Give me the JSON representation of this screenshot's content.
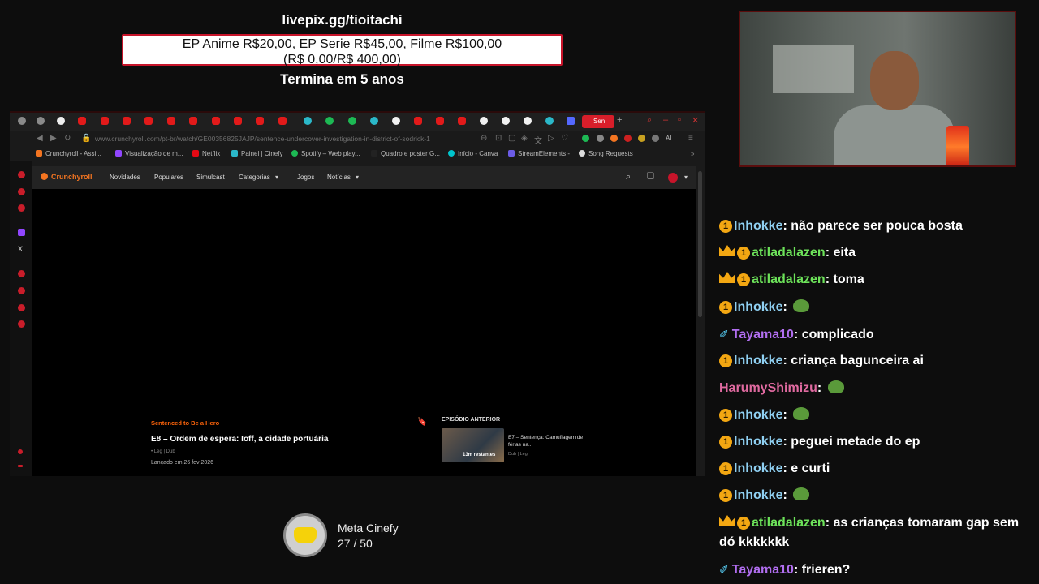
{
  "overlay": {
    "url": "livepix.gg/tioitachi",
    "prices_line1": "EP Anime R$20,00, EP Serie R$45,00, Filme R$100,00",
    "prices_line2": "(R$ 0,00/R$ 400,00)",
    "ends": "Termina em 5 anos"
  },
  "browser": {
    "active_tab": "Sen",
    "url": "www.crunchyroll.com/pt-br/watch/GE00356825JAJP/sentence-undercover-investigation-in-district-of-sodrick-1",
    "bookmarks": [
      "Crunchyroll - Assi...",
      "Visualização de m...",
      "Netflix",
      "Painel | Cinefy",
      "Spotify – Web play...",
      "Quadro e poster G...",
      "Início - Canva",
      "StreamElements -",
      "Song Requests"
    ],
    "ext_label": "AI"
  },
  "crunchyroll": {
    "logo": "Crunchyroll",
    "nav": [
      "Novidades",
      "Populares",
      "Simulcast",
      "Categorias",
      "Jogos",
      "Notícias"
    ],
    "series": "Sentenced to Be a Hero",
    "episode_title": "E8 – Ordem de espera: Ioff, a cidade portuária",
    "episode_meta": "• Leg | Dub",
    "release": "Lançado em 26 fev 2026",
    "prev_label": "EPISÓDIO ANTERIOR",
    "prev_title": "E7 – Sentença: Camuflagem de férias na...",
    "prev_meta": "Dub | Leg",
    "prev_remaining": "13m restantes"
  },
  "chat": {
    "messages": [
      {
        "user": "Inhokke",
        "text": "não parece ser pouca bosta",
        "badges": [
          "1"
        ],
        "color": "inh"
      },
      {
        "user": "atiladalazen",
        "text": "eita",
        "badges": [
          "crown",
          "1"
        ],
        "color": "atl"
      },
      {
        "user": "atiladalazen",
        "text": "toma",
        "badges": [
          "crown",
          "1"
        ],
        "color": "atl"
      },
      {
        "user": "Inhokke",
        "text": "",
        "badges": [
          "1"
        ],
        "color": "inh",
        "emote": "frog-emote"
      },
      {
        "user": "Tayama10",
        "text": "complicado",
        "badges": [
          "sword"
        ],
        "color": "tay"
      },
      {
        "user": "Inhokke",
        "text": "criança bagunceira ai",
        "badges": [
          "1"
        ],
        "color": "inh"
      },
      {
        "user": "HarumyShimizu",
        "text": "",
        "badges": [],
        "color": "har",
        "emote": "frog-emote"
      },
      {
        "user": "Inhokke",
        "text": "",
        "badges": [
          "1"
        ],
        "color": "inh",
        "emote": "frog-emote"
      },
      {
        "user": "Inhokke",
        "text": "peguei metade do ep",
        "badges": [
          "1"
        ],
        "color": "inh"
      },
      {
        "user": "Inhokke",
        "text": "e curti",
        "badges": [
          "1"
        ],
        "color": "inh"
      },
      {
        "user": "Inhokke",
        "text": "",
        "badges": [
          "1"
        ],
        "color": "inh",
        "emote": "frog-emote"
      },
      {
        "user": "atiladalazen",
        "text": "as crianças tomaram gap sem dó kkkkkkk",
        "badges": [
          "crown",
          "1"
        ],
        "color": "atl"
      },
      {
        "user": "Tayama10",
        "text": "frieren?",
        "badges": [
          "sword"
        ],
        "color": "tay"
      }
    ]
  },
  "goal": {
    "name": "Meta Cinefy",
    "progress": "27 / 50",
    "current": 27,
    "target": 50
  },
  "colors": {
    "accent_red": "#c7142a",
    "crunchyroll_orange": "#f47521",
    "badge_gold": "#f3a712"
  }
}
